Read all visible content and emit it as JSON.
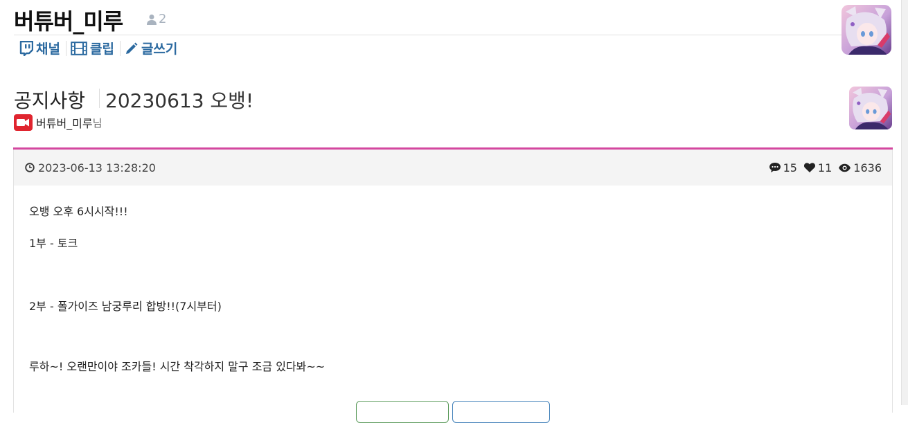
{
  "channel": {
    "title": "버튜버_미루",
    "member_count": "2",
    "nav": [
      {
        "label": "채널",
        "icon": "twitch-icon"
      },
      {
        "label": "클립",
        "icon": "film-icon"
      },
      {
        "label": "글쓰기",
        "icon": "pencil-icon"
      }
    ]
  },
  "post": {
    "category": "공지사항",
    "title": "20230613 오뱅!",
    "author": "버튜버_미루",
    "author_suffix": "님",
    "date": "2023-06-13 13:28:20",
    "comments": "15",
    "likes": "11",
    "views": "1636",
    "body": [
      "오뱅 오후 6시시작!!!",
      "1부 - 토크",
      "2부 - 폴가이즈 남궁루리 합방!!(7시부터)",
      "루하~! 오랜만이야 조카들! 시간 착각하지 말구 조금 있다봐~~"
    ]
  },
  "colors": {
    "accent": "#d4479f",
    "link": "#2c6aa0",
    "meta_bg": "#f4f4f4",
    "broadcast_red": "#e0252f"
  }
}
